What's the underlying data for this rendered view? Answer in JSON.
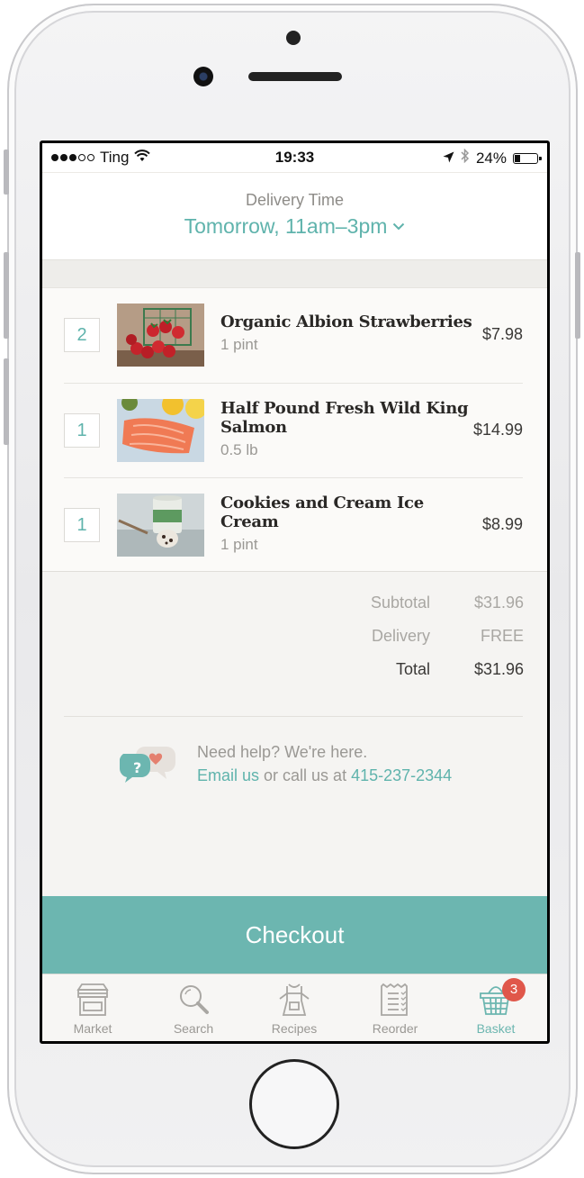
{
  "status_bar": {
    "carrier": "Ting",
    "time": "19:33",
    "battery": "24%",
    "battery_level": 0.24,
    "signal_bars": 3,
    "signal_total": 5
  },
  "delivery": {
    "label": "Delivery Time",
    "value": "Tomorrow, 11am–3pm"
  },
  "items": [
    {
      "qty": "2",
      "name": "Organic Albion Strawberries",
      "unit": "1 pint",
      "price": "$7.98",
      "image": "strawberries"
    },
    {
      "qty": "1",
      "name": "Half Pound Fresh Wild King Salmon",
      "unit": "0.5 lb",
      "price": "$14.99",
      "image": "salmon"
    },
    {
      "qty": "1",
      "name": "Cookies and Cream Ice Cream",
      "unit": "1 pint",
      "price": "$8.99",
      "image": "ice-cream"
    }
  ],
  "totals": {
    "subtotal_label": "Subtotal",
    "subtotal_value": "$31.96",
    "delivery_label": "Delivery",
    "delivery_value": "FREE",
    "total_label": "Total",
    "total_value": "$31.96"
  },
  "help": {
    "line1": "Need help? We're here.",
    "email_link": "Email us",
    "middle": " or call us at ",
    "phone": "415-237-2344"
  },
  "checkout_label": "Checkout",
  "tabs": [
    {
      "label": "Market",
      "icon": "storefront-icon"
    },
    {
      "label": "Search",
      "icon": "magnifier-icon"
    },
    {
      "label": "Recipes",
      "icon": "apron-icon"
    },
    {
      "label": "Reorder",
      "icon": "receipt-icon"
    },
    {
      "label": "Basket",
      "icon": "basket-icon",
      "badge": "3",
      "active": true
    }
  ],
  "colors": {
    "accent": "#6cb6b0",
    "link": "#5fb3ac",
    "badge": "#e0574a"
  }
}
